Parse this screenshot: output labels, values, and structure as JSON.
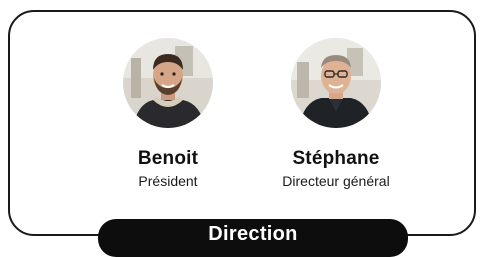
{
  "team": {
    "people": [
      {
        "name": "Benoit",
        "role": "Président",
        "photo": "portrait-photo"
      },
      {
        "name": "Stéphane",
        "role": "Directeur général",
        "photo": "portrait-photo"
      }
    ],
    "section_label": "Direction"
  },
  "colors": {
    "border": "#1a1a1a",
    "label_bg": "#0d0d0d",
    "label_text": "#ffffff"
  }
}
